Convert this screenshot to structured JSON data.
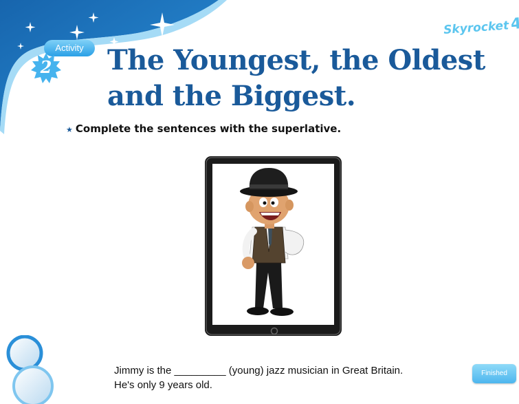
{
  "activity": {
    "label": "Activity",
    "number": "2"
  },
  "title": "The Youngest, the Oldest and the Biggest.",
  "brand": {
    "name": "Skyrocket",
    "level": "4"
  },
  "instruction": "Complete the sentences with the superlative.",
  "sentence": {
    "line1": "Jimmy is the _________ (young) jazz musician in Great Britain.",
    "line2": "He's only 9 years old."
  },
  "finish_button": "Finished",
  "colors": {
    "title": "#1a5a9a",
    "corner_blue": "#1f6fb6",
    "accent_light": "#5cc6ef"
  }
}
